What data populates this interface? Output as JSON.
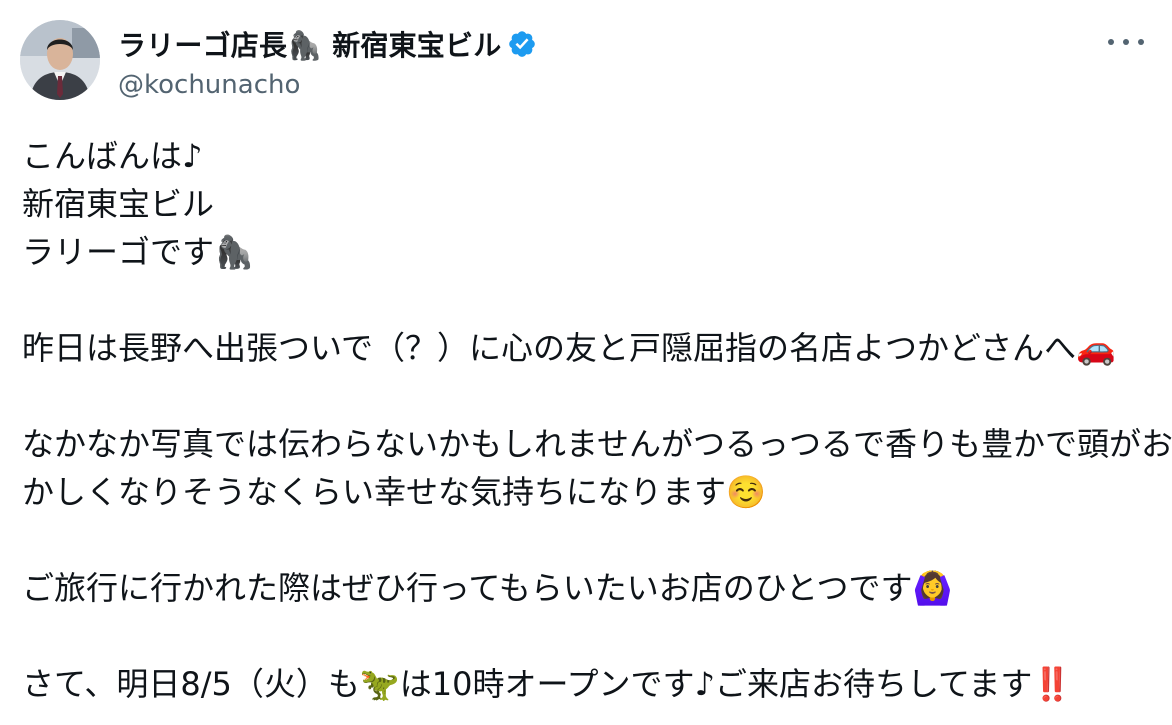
{
  "author": {
    "display_name": "ラリーゴ店長🦍 新宿東宝ビル",
    "handle": "@kochunacho",
    "verified": true,
    "verified_color": "#1d9bf0",
    "more_icon": "more-horizontal-icon"
  },
  "text": {
    "l1": "こんばんは♪",
    "l2": "新宿東宝ビル",
    "l3": "ラリーゴです🦍",
    "l4": "昨日は長野へ出張ついで（？）に心の友と戸隠屈指の名店よつかどさんへ🚗",
    "l5": "なかなか写真では伝わらないかもしれませんがつるっつるで香りも豊かで頭がお",
    "l6": "かしくなりそうなくらい幸せな気持ちになります☺️",
    "l7": "ご旅行に行かれた際はぜひ行ってもらいたいお店のひとつです🙆‍♀️",
    "l8": "さて、明日8/5（火）も🦖は10時オープンです♪ご来店お待ちしてます‼️"
  }
}
